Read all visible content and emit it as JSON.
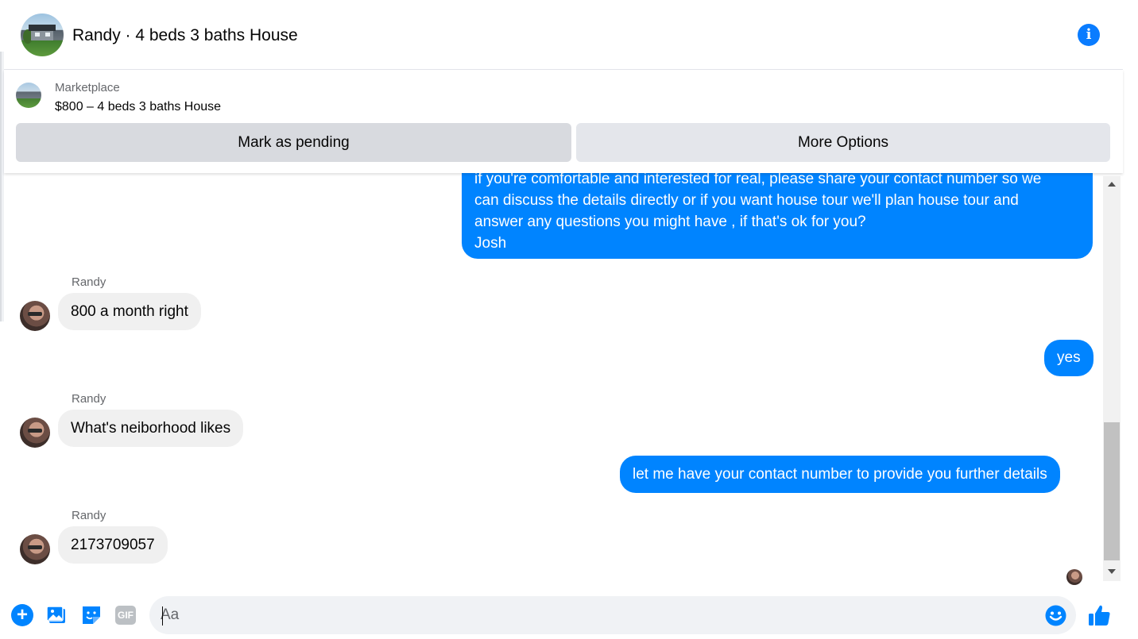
{
  "header": {
    "title": "Randy · 4 beds 3 baths House",
    "info_icon": "info-icon"
  },
  "marketplace": {
    "label": "Marketplace",
    "listing": "$800 – 4 beds 3 baths House",
    "mark_pending_label": "Mark as pending",
    "more_options_label": "More Options"
  },
  "messages": [
    {
      "direction": "outgoing",
      "lines": [
        "if you're comfortable and interested for real, please share your contact number so we",
        "can discuss the details directly or if you  want house tour we'll plan house tour and",
        "answer any questions you might have , if that's ok for you?",
        "Josh"
      ]
    },
    {
      "direction": "incoming",
      "sender": "Randy",
      "text": "800 a month right"
    },
    {
      "direction": "outgoing",
      "text": "yes"
    },
    {
      "direction": "incoming",
      "sender": "Randy",
      "text": "What's neiborhood likes"
    },
    {
      "direction": "outgoing",
      "text": "let me have your contact number to provide you further details"
    },
    {
      "direction": "incoming",
      "sender": "Randy",
      "text": "2173709057"
    }
  ],
  "composer": {
    "placeholder": "Aa",
    "gif_label": "GIF",
    "icons": [
      "plus-icon",
      "photo-icon",
      "sticker-icon",
      "gif-icon",
      "emoji-icon",
      "like-icon"
    ]
  },
  "colors": {
    "accent": "#0084ff",
    "outgoing_bubble": "#0084ff",
    "incoming_bubble": "#f0f0f0",
    "pending_button": "#d8dadf",
    "more_button": "#e4e6eb"
  }
}
